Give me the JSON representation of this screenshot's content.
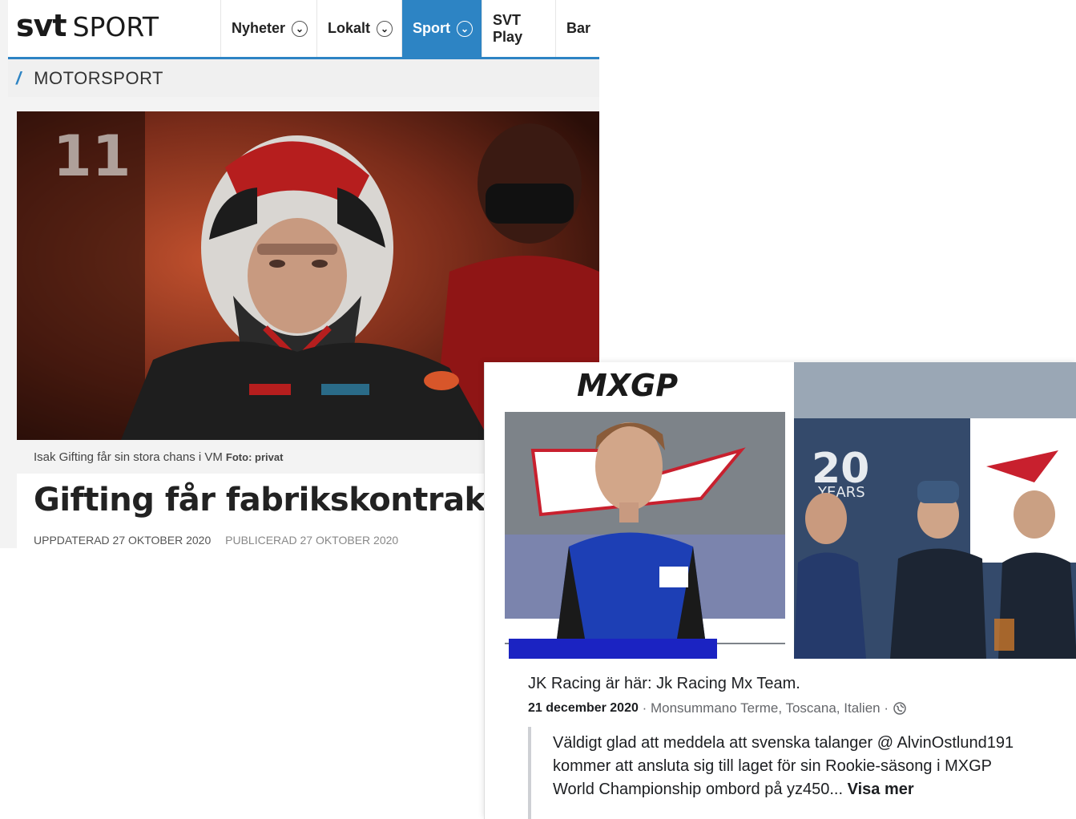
{
  "svt": {
    "logo_svt": "svt",
    "logo_sport": "SPORT",
    "nav": [
      {
        "label": "Nyheter",
        "dropdown": true,
        "active": false
      },
      {
        "label": "Lokalt",
        "dropdown": true,
        "active": false
      },
      {
        "label": "Sport",
        "dropdown": true,
        "active": true
      },
      {
        "label": "SVT Play",
        "dropdown": false,
        "active": false
      },
      {
        "label": "Bar",
        "dropdown": false,
        "active": false
      }
    ],
    "section_label": "MOTORSPORT",
    "hero_number": "11",
    "caption": "Isak Gifting får sin stora chans i VM",
    "caption_credit": "Foto: privat",
    "headline": "Gifting får fabrikskontrakt",
    "updated": "UPPDATERAD 27 OKTOBER 2020",
    "published": "PUBLICERAD 27 OKTOBER 2020",
    "accent_color": "#2d84c4"
  },
  "facebook": {
    "mxgp_logo": "MXGP",
    "banner_years": "20",
    "banner_years_word": "YEARS",
    "page_name": "JK Racing",
    "is_at": "är här:",
    "place": "Jk Racing Mx Team.",
    "date": "21 december 2020",
    "location": "Monsummano Terme, Toscana, Italien",
    "body": "Väldigt glad att meddela att svenska talanger @ AlvinOstlund191 kommer att ansluta sig till laget för sin Rookie-säsong i MXGP World Championship ombord på yz450...",
    "see_more": "Visa mer"
  }
}
